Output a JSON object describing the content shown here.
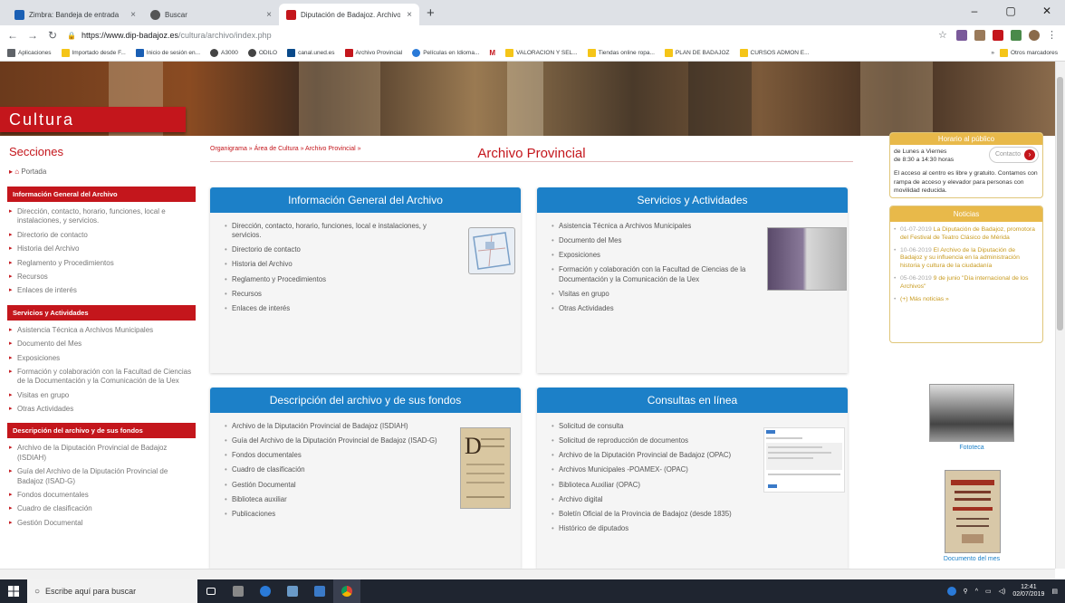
{
  "browser": {
    "tabs": [
      {
        "label": "Zimbra: Bandeja de entrada",
        "color": "#1a5fb4"
      },
      {
        "label": "Buscar",
        "color": "#555555"
      },
      {
        "label": "Diputación de Badajoz. Archivo",
        "color": "#c4161c"
      }
    ],
    "new_tab": "+",
    "url_host": "https://www.dip-badajoz.es",
    "url_path": "/cultura/archivo/index.php",
    "bookmarks": [
      {
        "label": "Aplicaciones",
        "icon": "apps-icon"
      },
      {
        "label": "Importado desde F...",
        "icon": "folder-icon"
      },
      {
        "label": "Inicio de sesión en...",
        "icon": "zimbra-icon"
      },
      {
        "label": "A3000",
        "icon": "globe-icon"
      },
      {
        "label": "ODILO",
        "icon": "globe-icon"
      },
      {
        "label": "canal.uned.es",
        "icon": "uned-icon"
      },
      {
        "label": "Archivo Provincial",
        "icon": "dip-icon"
      },
      {
        "label": "Películas en Idioma...",
        "icon": "film-icon"
      },
      {
        "label": "M",
        "icon": "gmail-icon"
      },
      {
        "label": "VALORACION Y SEL...",
        "icon": "folder-icon"
      },
      {
        "label": "Tiendas online ropa...",
        "icon": "folder-icon"
      },
      {
        "label": "PLAN DE BADAJOZ",
        "icon": "folder-icon"
      },
      {
        "label": "CURSOS ADMON E...",
        "icon": "folder-icon"
      }
    ],
    "more_bookmarks": "»",
    "other_bookmarks": "Otros marcadores"
  },
  "site": {
    "banner_title": "Cultura",
    "breadcrumb": "Organigrama » Área de Cultura » Archivo Provincial »",
    "page_title": "Archivo Provincial"
  },
  "sidebar": {
    "title": "Secciones",
    "portada": "Portada",
    "groups": [
      {
        "heading": "Información General del Archivo",
        "items": [
          "Dirección, contacto, horario, funciones, local e instalaciones, y servicios.",
          "Directorio de contacto",
          "Historia del Archivo",
          "Reglamento y Procedimientos",
          "Recursos",
          "Enlaces de interés"
        ]
      },
      {
        "heading": "Servicios y Actividades",
        "items": [
          "Asistencia Técnica a Archivos Municipales",
          "Documento del Mes",
          "Exposiciones",
          "Formación y colaboración con la Facultad de Ciencias de la Documentación y la Comunicación de la Uex",
          "Visitas en grupo",
          "Otras Actividades"
        ]
      },
      {
        "heading": "Descripción del archivo y de sus fondos",
        "items": [
          "Archivo de la Diputación Provincial de Badajoz (ISDIAH)",
          "Guía del Archivo de la Diputación Provincial de Badajoz (ISAD-G)",
          "Fondos documentales",
          "Cuadro de clasificación",
          "Gestión Documental"
        ]
      }
    ]
  },
  "boxes": [
    {
      "title": "Información General del Archivo",
      "items": [
        "Dirección, contacto, horario, funciones, local e instalaciones, y servicios.",
        "Directorio de contacto",
        "Historia del Archivo",
        "Reglamento y Procedimientos",
        "Recursos",
        "Enlaces de interés"
      ]
    },
    {
      "title": "Servicios y Actividades",
      "items": [
        "Asistencia Técnica a Archivos Municipales",
        "Documento del Mes",
        "Exposiciones",
        "Formación y colaboración con la Facultad de Ciencias de la Documentación y la Comunicación de la Uex",
        "Visitas en grupo",
        "Otras Actividades"
      ]
    },
    {
      "title": "Descripción del archivo y de sus fondos",
      "items": [
        "Archivo de la Diputación Provincial de Badajoz (ISDIAH)",
        "Guía del Archivo de la Diputación Provincial de Badajoz (ISAD-G)",
        "Fondos documentales",
        "Cuadro de clasificación",
        "Gestión Documental",
        "Biblioteca auxiliar",
        "Publicaciones"
      ]
    },
    {
      "title": "Consultas en línea",
      "items": [
        "Solicitud de consulta",
        "Solicitud de reproducción de documentos",
        "Archivo de la Diputación Provincial de Badajoz (OPAC)",
        "Archivos Municipales -POAMEX- (OPAC)",
        "Biblioteca Auxiliar (OPAC)",
        "Archivo digital",
        "Boletín Oficial de la Provincia de Badajoz (desde 1835)",
        "Histórico de diputados"
      ]
    }
  ],
  "horario": {
    "title": "Horario al público",
    "contacto": "Contacto",
    "days": "de Lunes a Viernes",
    "hours": "de 8:30 a 14:30 horas",
    "note": "El acceso al centro es libre y gratuito. Contamos con rampa de acceso y elevador para personas con movilidad reducida."
  },
  "noticias": {
    "title": "Noticias",
    "items": [
      {
        "date": "01-07-2019",
        "text": "La Diputación de Badajoz, promotora del Festival de Teatro Clásico de Mérida"
      },
      {
        "date": "10-06-2019",
        "text": "El Archivo de la Diputación de Badajoz y su influencia en la administración historia y cultura de la ciudadanía"
      },
      {
        "date": "05-06-2019",
        "text": "9 de junio \"Día internacional de los Archivos\""
      }
    ],
    "more": "(+) Más noticias »"
  },
  "right_images": {
    "fototeca": "Fototeca",
    "documento": "Documento del mes"
  },
  "taskbar": {
    "search_placeholder": "Escribe aquí para buscar",
    "time": "12:41",
    "date": "02/07/2019"
  }
}
